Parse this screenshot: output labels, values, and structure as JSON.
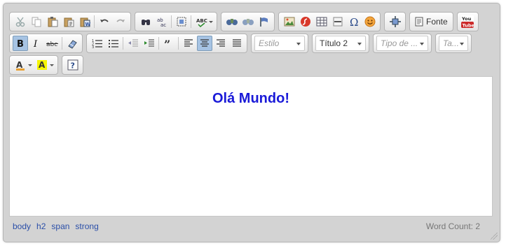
{
  "toolbar": {
    "source_label": "Fonte",
    "style_combo": "Estilo",
    "format_combo": "Título 2",
    "font_combo": "Tipo de ...",
    "size_combo": "Ta..."
  },
  "content": {
    "heading": "Olá Mundo!",
    "heading_color": "#1a1ad8"
  },
  "statusbar": {
    "path": [
      "body",
      "h2",
      "span",
      "strong"
    ],
    "word_count": "Word Count: 2"
  },
  "icons": [
    "cut-icon",
    "copy-icon",
    "paste-icon",
    "paste-text-icon",
    "paste-word-icon",
    "undo-icon",
    "redo-icon",
    "find-icon",
    "replace-icon",
    "select-all-icon",
    "spellcheck-icon",
    "form-icon",
    "anchor-icon",
    "flag-icon",
    "image-icon",
    "flash-icon",
    "table-icon",
    "horizontal-rule-icon",
    "special-char-icon",
    "smiley-icon",
    "maximize-icon",
    "source-icon",
    "youtube-icon",
    "bold-icon",
    "italic-icon",
    "strike-icon",
    "remove-format-icon",
    "numbered-list-icon",
    "bulleted-list-icon",
    "outdent-icon",
    "indent-icon",
    "blockquote-icon",
    "align-left-icon",
    "align-center-icon",
    "align-right-icon",
    "justify-icon",
    "text-color-icon",
    "bg-color-icon",
    "about-icon"
  ]
}
